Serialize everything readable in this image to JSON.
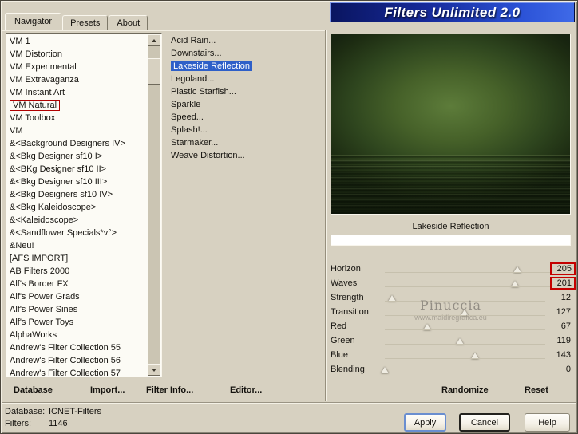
{
  "window": {
    "logo_title": "Filters Unlimited 2.0"
  },
  "tabs": {
    "items": [
      {
        "label": "Navigator",
        "active": true
      },
      {
        "label": "Presets",
        "active": false
      },
      {
        "label": "About",
        "active": false
      }
    ]
  },
  "categories": {
    "selected": "VM Natural",
    "items": [
      "VM 1",
      "VM Distortion",
      "VM Experimental",
      "VM Extravaganza",
      "VM Instant Art",
      "VM Natural",
      "VM Toolbox",
      "VM",
      "&<Background Designers IV>",
      "&<Bkg Designer sf10 I>",
      "&<BKg Designer sf10 II>",
      "&<Bkg Designer sf10 III>",
      "&<Bkg Designers sf10 IV>",
      "&<Bkg Kaleidoscope>",
      "&<Kaleidoscope>",
      "&<Sandflower Specials*v°>",
      "&Neu!",
      "[AFS IMPORT]",
      "AB Filters 2000",
      "Alf's Border FX",
      "Alf's Power Grads",
      "Alf's Power Sines",
      "Alf's Power Toys",
      "AlphaWorks",
      "Andrew's Filter Collection 55",
      "Andrew's Filter Collection 56",
      "Andrew's Filter Collection 57"
    ]
  },
  "filters": {
    "selected": "Lakeside Reflection",
    "items": [
      "Acid Rain...",
      "Downstairs...",
      "Lakeside Reflection",
      "Legoland...",
      "Plastic Starfish...",
      "Sparkle",
      "Speed...",
      "Splash!...",
      "Starmaker...",
      "Weave Distortion..."
    ]
  },
  "preview": {
    "caption": "Lakeside Reflection"
  },
  "params": {
    "max": 255,
    "items": [
      {
        "label": "Horizon",
        "value": 205,
        "highlight": true
      },
      {
        "label": "Waves",
        "value": 201,
        "highlight": true
      },
      {
        "label": "Strength",
        "value": 12,
        "highlight": false
      },
      {
        "label": "Transition",
        "value": 127,
        "highlight": false
      },
      {
        "label": "Red",
        "value": 67,
        "highlight": false
      },
      {
        "label": "Green",
        "value": 119,
        "highlight": false
      },
      {
        "label": "Blue",
        "value": 143,
        "highlight": false
      },
      {
        "label": "Blending",
        "value": 0,
        "highlight": false
      }
    ]
  },
  "toolbar": {
    "database": "Database",
    "import": "Import...",
    "filter_info": "Filter Info...",
    "editor": "Editor...",
    "randomize": "Randomize",
    "reset": "Reset"
  },
  "status": {
    "database_label": "Database:",
    "database_value": "ICNET-Filters",
    "filters_label": "Filters:",
    "filters_value": "1146"
  },
  "actions": {
    "apply": "Apply",
    "cancel": "Cancel",
    "help": "Help"
  },
  "watermark": {
    "line1": "Pinuccia",
    "line2": "www.maidiregrafica.eu"
  },
  "colors": {
    "dialog_bg": "#d7d1c1",
    "banner_from": "#0a1560",
    "banner_to": "#3f6ae8",
    "selection": "#2e5fc8",
    "annotation": "#c40000"
  }
}
